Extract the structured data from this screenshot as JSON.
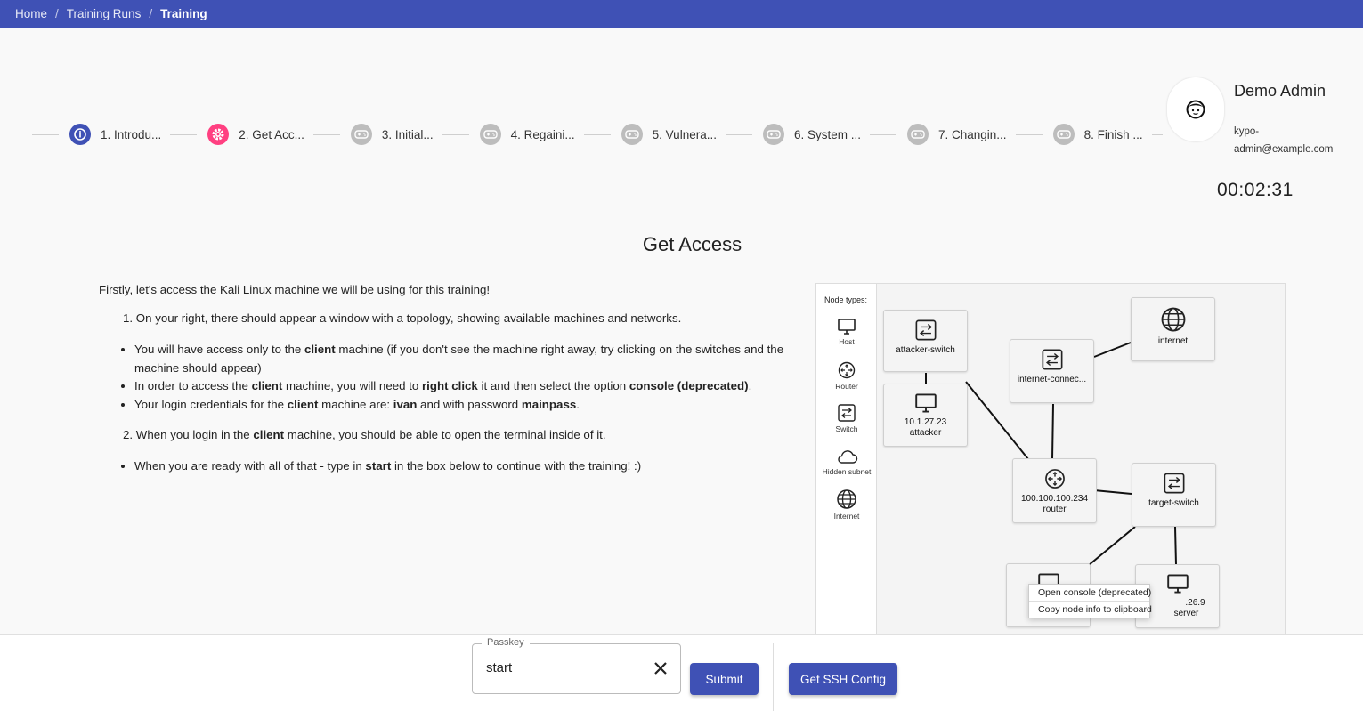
{
  "breadcrumb": {
    "home": "Home",
    "training_runs": "Training Runs",
    "current": "Training",
    "separator": "/"
  },
  "steps": [
    {
      "label": "1. Introdu...",
      "icon": "info-icon",
      "state": "done"
    },
    {
      "label": "2. Get Acc...",
      "icon": "gear-icon",
      "state": "active"
    },
    {
      "label": "3. Initial...",
      "icon": "gamepad-icon",
      "state": "locked"
    },
    {
      "label": "4. Regaini...",
      "icon": "gamepad-icon",
      "state": "locked"
    },
    {
      "label": "5. Vulnera...",
      "icon": "gamepad-icon",
      "state": "locked"
    },
    {
      "label": "6. System ...",
      "icon": "gamepad-icon",
      "state": "locked"
    },
    {
      "label": "7. Changin...",
      "icon": "gamepad-icon",
      "state": "locked"
    },
    {
      "label": "8. Finish ...",
      "icon": "gamepad-icon",
      "state": "locked"
    }
  ],
  "user": {
    "name": "Demo Admin",
    "email": "kypo-admin@example.com",
    "avatar_icon": "face-icon"
  },
  "timer": "00:02:31",
  "level": {
    "title": "Get Access",
    "intro": "Firstly, let's access the Kali Linux machine we will be using for this training!",
    "item1": "1. On your right, there should appear a window with a topology, showing available machines and networks.",
    "bullet1_a": "You will have access only to the ",
    "bullet1_b": "client",
    "bullet1_c": " machine (if you don't see the machine right away, try clicking on the switches and the machine should appear)",
    "bullet2_a": "In order to access the ",
    "bullet2_b": "client",
    "bullet2_c": " machine, you will need to ",
    "bullet2_d": "right click",
    "bullet2_e": " it and then select the option ",
    "bullet2_f": "console (deprecated)",
    "bullet2_g": ".",
    "bullet3_a": "Your login credentials for the ",
    "bullet3_b": "client",
    "bullet3_c": " machine are: ",
    "bullet3_d": "ivan",
    "bullet3_e": " and with password ",
    "bullet3_f": "mainpass",
    "bullet3_g": ".",
    "item2_a": "2. When you login in the ",
    "item2_b": "client",
    "item2_c": " machine, you should be able to open the terminal inside of it.",
    "bullet4_a": "When you are ready with all of that - type in ",
    "bullet4_b": "start",
    "bullet4_c": " in the box below to continue with the training! :)"
  },
  "topology": {
    "legend_title": "Node types:",
    "legend": [
      {
        "label": "Host",
        "icon": "monitor-icon"
      },
      {
        "label": "Router",
        "icon": "router-icon"
      },
      {
        "label": "Switch",
        "icon": "switch-icon"
      },
      {
        "label": "Hidden subnet",
        "icon": "cloud-icon"
      },
      {
        "label": "Internet",
        "icon": "globe-icon"
      }
    ],
    "nodes": {
      "attacker_switch": "attacker-switch",
      "attacker_ip": "10.1.27.23",
      "attacker_name": "attacker",
      "internet_connector": "internet-connec...",
      "internet": "internet",
      "router_ip": "100.100.100.234",
      "router_name": "router",
      "target_switch": "target-switch",
      "server_ip": ".26.9",
      "server_name": "server"
    },
    "context_menu": [
      "Open console (deprecated)",
      "Copy node info to clipboard"
    ]
  },
  "passkey": {
    "label": "Passkey",
    "value": "start"
  },
  "buttons": {
    "submit": "Submit",
    "ssh": "Get SSH Config"
  },
  "colors": {
    "primary": "#3f51b5",
    "accent": "#ff4081",
    "locked": "#bdbdbd"
  }
}
